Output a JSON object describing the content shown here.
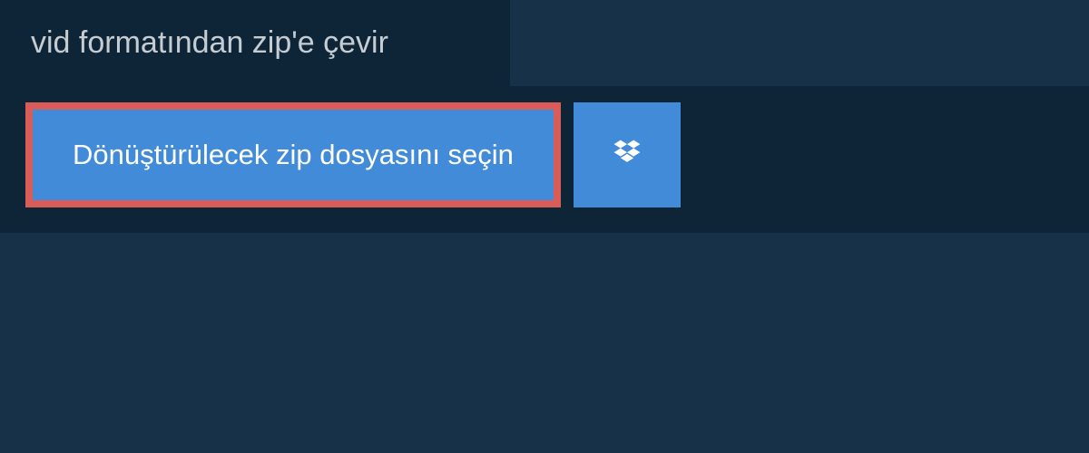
{
  "header": {
    "title": "vid formatından zip'e çevir"
  },
  "dropzone": {
    "select_label": "Dönüştürülecek zip dosyasını seçin"
  },
  "colors": {
    "page_bg": "#163148",
    "panel_bg": "#0e2538",
    "button_bg": "#428bd8",
    "highlight_border": "#d95c59",
    "text_light": "#c5ccd2",
    "text_white": "#ffffff"
  }
}
